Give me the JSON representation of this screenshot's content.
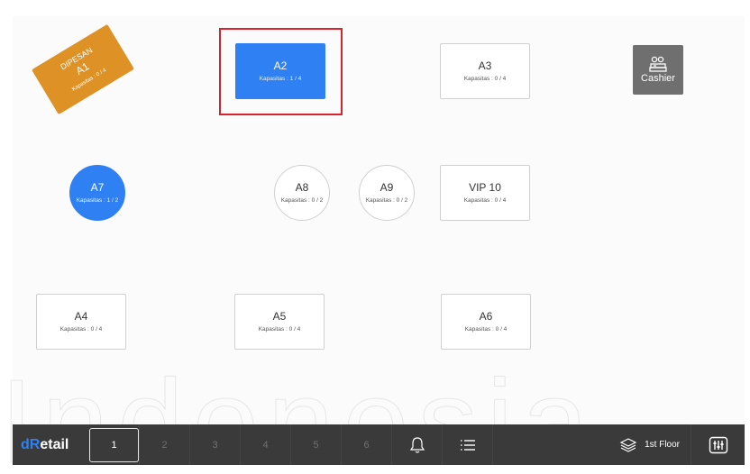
{
  "tables": [
    {
      "id": "A1",
      "name": "A1",
      "capacity": "Kapasitas : 0 / 4",
      "status": "DIPESAN",
      "state": "booked"
    },
    {
      "id": "A2",
      "name": "A2",
      "capacity": "Kapasitas : 1 / 4",
      "state": "active",
      "selected": true
    },
    {
      "id": "A3",
      "name": "A3",
      "capacity": "Kapasitas : 0 / 4",
      "state": "empty"
    },
    {
      "id": "A7",
      "name": "A7",
      "capacity": "Kapasitas : 1 / 2",
      "state": "active"
    },
    {
      "id": "A8",
      "name": "A8",
      "capacity": "Kapasitas : 0 / 2",
      "state": "empty"
    },
    {
      "id": "A9",
      "name": "A9",
      "capacity": "Kapasitas : 0 / 2",
      "state": "empty"
    },
    {
      "id": "VIP10",
      "name": "VIP 10",
      "capacity": "Kapasitas : 0 / 4",
      "state": "empty"
    },
    {
      "id": "A4",
      "name": "A4",
      "capacity": "Kapasitas : 0 / 4",
      "state": "empty"
    },
    {
      "id": "A5",
      "name": "A5",
      "capacity": "Kapasitas : 0 / 4",
      "state": "empty"
    },
    {
      "id": "A6",
      "name": "A6",
      "capacity": "Kapasitas : 0 / 4",
      "state": "empty"
    }
  ],
  "cashier": {
    "label": "Cashier",
    "icon": "cash-register-icon"
  },
  "bottom_bar": {
    "logo_prefix": "d",
    "logo_mid": "R",
    "logo_suffix": "etail",
    "pages": [
      "1",
      "2",
      "3",
      "4",
      "5",
      "6"
    ],
    "current_page": "1",
    "notification_icon": "bell-icon",
    "list_icon": "list-icon",
    "floor_icon": "layers-icon",
    "floor_label": "1st Floor",
    "settings_icon": "sliders-icon"
  },
  "colors": {
    "active": "#2f80f3",
    "booked": "#de9124",
    "cashier": "#6f6f6f",
    "selection": "#d8222c",
    "bar": "#3a3a3a"
  }
}
